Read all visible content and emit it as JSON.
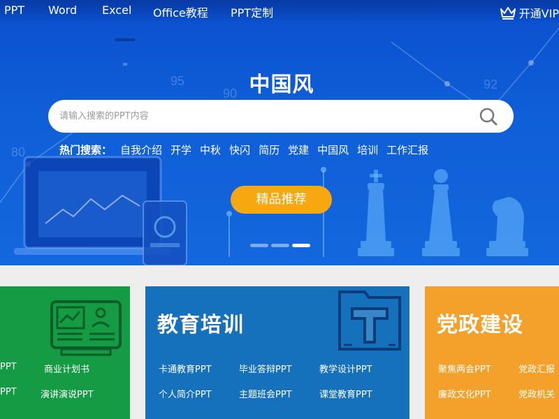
{
  "nav": {
    "items": [
      {
        "label": "PPT"
      },
      {
        "label": "Word"
      },
      {
        "label": "Excel"
      },
      {
        "label": "Office教程"
      },
      {
        "label": "PPT定制"
      }
    ],
    "vip_label": "开通VIP",
    "vip_icon": "crown-icon"
  },
  "hero": {
    "title": "中国风",
    "search": {
      "placeholder": "请输入搜索的PPT内容",
      "value": "",
      "icon": "search-icon"
    },
    "hot": {
      "label": "热门搜索：",
      "terms": [
        "自我介绍",
        "开学",
        "中秋",
        "快闪",
        "简历",
        "党建",
        "中国风",
        "培训",
        "工作汇报"
      ]
    },
    "featured_label": "精品推荐",
    "carousel": {
      "count": 3,
      "active_index": 2
    },
    "background_numbers": [
      "80",
      "95",
      "90",
      "92"
    ],
    "accent_color": "#f7a70f"
  },
  "cards": {
    "business": {
      "color": "#159b43",
      "links": [
        "PPT",
        "商业计划书",
        "PPT",
        "演讲演说PPT"
      ]
    },
    "education": {
      "color": "#1571bc",
      "title": "教育培训",
      "links": [
        "卡通教育PPT",
        "毕业答辩PPT",
        "教学设计PPT",
        "个人简介PPT",
        "主题班会PPT",
        "课堂教育PPT"
      ]
    },
    "party": {
      "color": "#f3a12b",
      "title": "党政建设",
      "links": [
        "聚焦两会PPT",
        "党政汇报",
        "廉政文化PPT",
        "党政机关"
      ]
    }
  }
}
